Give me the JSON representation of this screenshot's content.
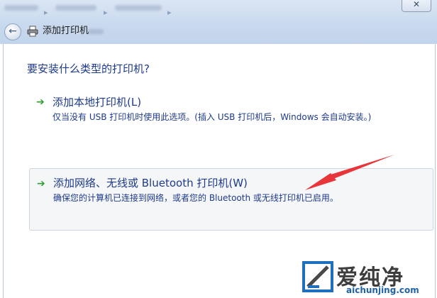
{
  "window": {
    "title": "添加打印机",
    "close_glyph": "✕"
  },
  "page": {
    "question": "要安装什么类型的打印机?"
  },
  "options": [
    {
      "label": "添加本地打印机(L)",
      "description": "仅当没有 USB 打印机时使用此选项。(插入 USB 打印机后，Windows 会自动安装。)"
    },
    {
      "label": "添加网络、无线或 Bluetooth 打印机(W)",
      "description": "确保您的计算机已连接到网络，或者您的 Bluetooth 或无线打印机已启用。"
    }
  ],
  "watermark": {
    "text": "爱纯净",
    "url": "aichunjing.com"
  },
  "colors": {
    "link_blue": "#1e3a8a",
    "arrow_green": "#2e9e2e",
    "annotation_red": "#e8353a",
    "chrome_blue": "#c9d9ee"
  }
}
